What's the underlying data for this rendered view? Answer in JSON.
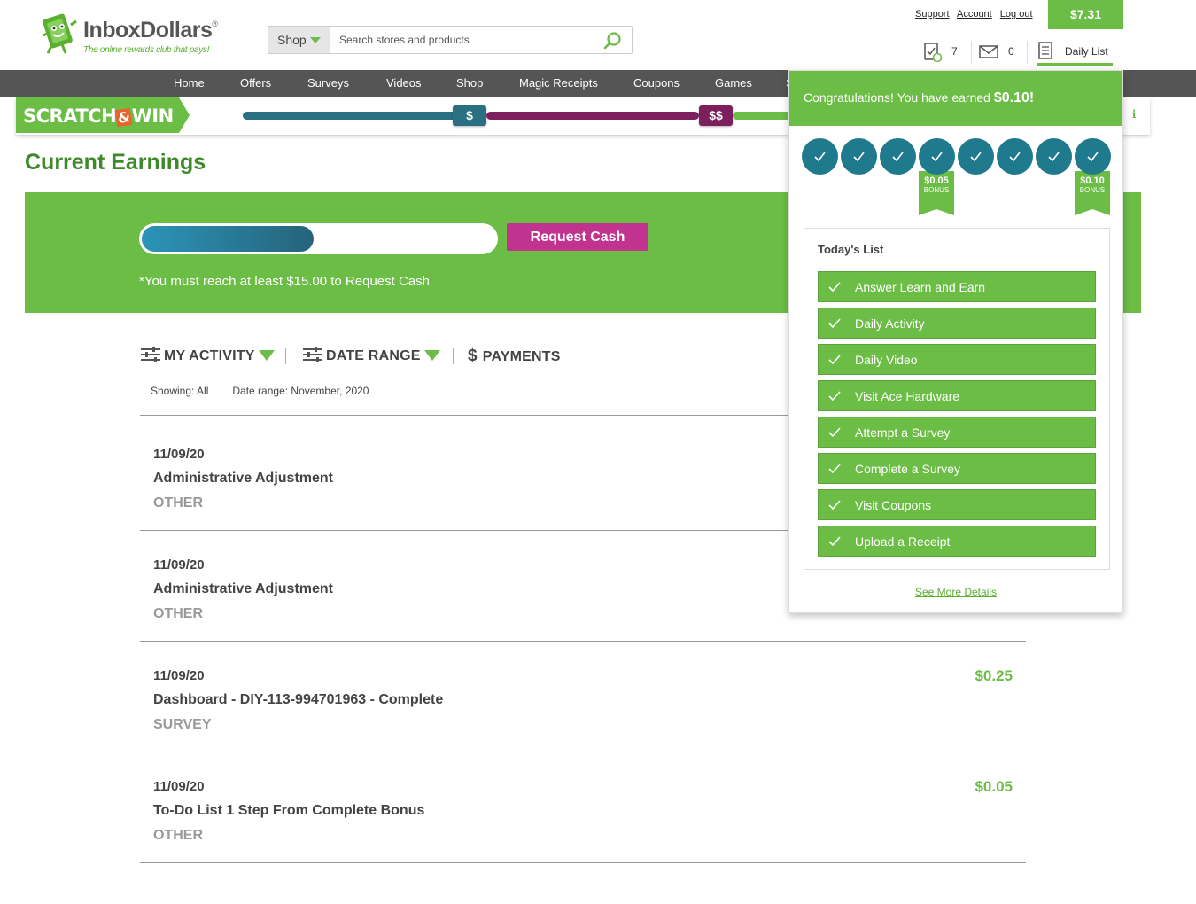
{
  "header": {
    "logo_name": "InboxDollars",
    "logo_reg": "®",
    "logo_tagline": "The online rewards club that pays!",
    "search": {
      "category": "Shop",
      "placeholder": "Search stores and products"
    },
    "links": [
      "Support",
      "Account",
      "Log out"
    ],
    "balance": "$7.31",
    "tasks_count": "7",
    "messages_count": "0",
    "daily_list_label": "Daily List"
  },
  "nav": [
    "Home",
    "Offers",
    "Surveys",
    "Videos",
    "Shop",
    "Magic Receipts",
    "Coupons",
    "Games",
    "S"
  ],
  "scratch": {
    "logo_left": "SCRATCH",
    "logo_amp": "&",
    "logo_right": "WIN",
    "marker1": "$",
    "marker2": "$$",
    "info": "i"
  },
  "earnings": {
    "title": "Current Earnings",
    "request_cash": "Request Cash",
    "note": "*You must reach at least $15.00 to Request Cash",
    "progress_fraction": 0.487
  },
  "filters": {
    "my_activity": "MY ACTIVITY",
    "date_range": "DATE RANGE",
    "payments_icon": "$",
    "payments": "PAYMENTS",
    "showing": "Showing: All",
    "date_range_value": "Date range: November, 2020"
  },
  "activities": [
    {
      "date": "11/09/20",
      "title": "Administrative Adjustment",
      "category": "OTHER",
      "amount": ""
    },
    {
      "date": "11/09/20",
      "title": "Administrative Adjustment",
      "category": "OTHER",
      "amount": ""
    },
    {
      "date": "11/09/20",
      "title": "Dashboard - DIY-113-994701963 - Complete",
      "category": "SURVEY",
      "amount": "$0.25"
    },
    {
      "date": "11/09/20",
      "title": "To-Do List 1 Step From Complete Bonus",
      "category": "OTHER",
      "amount": "$0.05"
    }
  ],
  "daily_list": {
    "congrats_text": "Congratulations! You have earned ",
    "congrats_amount": "$0.10!",
    "bonus1_amount": "$0.05",
    "bonus1_label": "BONUS",
    "bonus2_amount": "$0.10",
    "bonus2_label": "BONUS",
    "today_title": "Today's List",
    "tasks": [
      "Answer Learn and Earn",
      "Daily Activity",
      "Daily Video",
      "Visit Ace Hardware",
      "Attempt a Survey",
      "Complete a Survey",
      "Visit Coupons",
      "Upload a Receipt"
    ],
    "see_more": "See More Details"
  },
  "colors": {
    "brand_green": "#6bbd45",
    "dark_green": "#3e8a2a",
    "teal": "#1f7a8e",
    "magenta": "#c2338f",
    "nav_gray": "#555555"
  },
  "icons": [
    "money-mascot-icon",
    "search-icon",
    "task-check-icon",
    "envelope-icon",
    "daily-list-icon",
    "sliders-icon",
    "check-icon",
    "info-icon"
  ]
}
